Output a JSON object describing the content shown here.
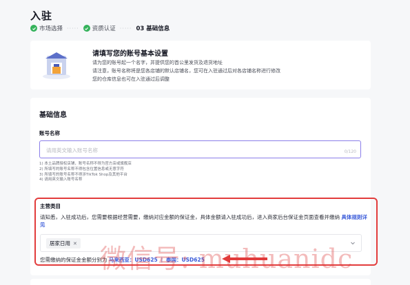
{
  "page": {
    "title": "入驻"
  },
  "steps": [
    {
      "label": "市场选择",
      "status": "done"
    },
    {
      "label": "资质认证",
      "status": "done"
    },
    {
      "label": "03 基础信息",
      "status": "current"
    }
  ],
  "info": {
    "title": "请填写您的账号基本设置",
    "lines": [
      "请为您的账号起一个名字，并提供您的首公里发货及退货地址",
      "请注意，账号名称将是您各店铺的默认店铺名，您可在入驻通过后对各店铺名称进行修改",
      "您的仓库信息也可在入驻通过后调整"
    ]
  },
  "form": {
    "section_title": "基础信息",
    "account_label": "账号名称",
    "account_placeholder": "请用英文输入账号名称",
    "account_count": "0/120",
    "hints": [
      "1) 本土品牌授权店铺，账号名称不得为官方店或旗舰店",
      "2) 所填写的账号名称不得包含位置信息或无意字符",
      "3) 所填写的账号名称不得涉TikTok Shop及其他平台",
      "4) 请用英文输入账号名称"
    ],
    "main_category_label": "主营类目",
    "main_category_desc": "请知悉，入驻成功后，您需要根据经营需要，缴纳对应金额的保证金，具体金额请入驻成功后，进入商家后台保证金页面查看并缴纳",
    "rules_link": "具体规则详见",
    "selected_tag": "居家日用",
    "deposit_prefix": "您需缴纳的保证金金额分别为",
    "deposit_malaysia": "马来西亚：USD625",
    "deposit_sep": "｜",
    "deposit_thailand": "泰国：USD625"
  },
  "watermark": "微信号: muhuanidc",
  "colors": {
    "accent": "#8a7de9",
    "link": "#3a5bd9",
    "success": "#35b25b",
    "highlight": "#e23b3b"
  }
}
